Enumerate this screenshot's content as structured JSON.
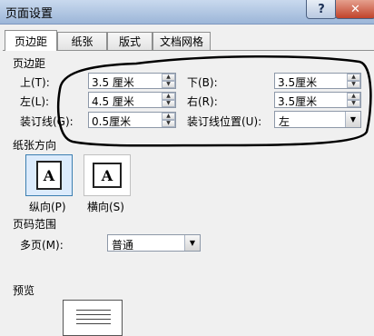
{
  "window": {
    "title": "页面设置",
    "help": "?",
    "close": "✕"
  },
  "tabs": [
    "页边距",
    "纸张",
    "版式",
    "文档网格"
  ],
  "margins": {
    "section": "页边距",
    "top_label": "上(T):",
    "top_value": "3.5 厘米",
    "bottom_label": "下(B):",
    "bottom_value": "3.5厘米",
    "left_label": "左(L):",
    "left_value": "4.5 厘米",
    "right_label": "右(R):",
    "right_value": "3.5厘米",
    "gutter_label": "装订线(G):",
    "gutter_value": "0.5厘米",
    "gutter_pos_label": "装订线位置(U):",
    "gutter_pos_value": "左"
  },
  "orientation": {
    "section": "纸张方向",
    "portrait_label": "纵向(P)",
    "landscape_label": "横向(S)",
    "glyph": "A",
    "selected": "portrait"
  },
  "pages": {
    "section": "页码范围",
    "multiple_label": "多页(M):",
    "multiple_value": "普通"
  },
  "preview": {
    "section": "预览"
  },
  "colors": {
    "annotation_ink": "#000000",
    "selection_border": "#3c7fb1",
    "selection_fill": "#dcebfc"
  },
  "icons": [
    "help-icon",
    "close-icon",
    "spin-up-icon",
    "spin-down-icon",
    "dropdown-arrow-icon",
    "portrait-page-icon",
    "landscape-page-icon"
  ]
}
